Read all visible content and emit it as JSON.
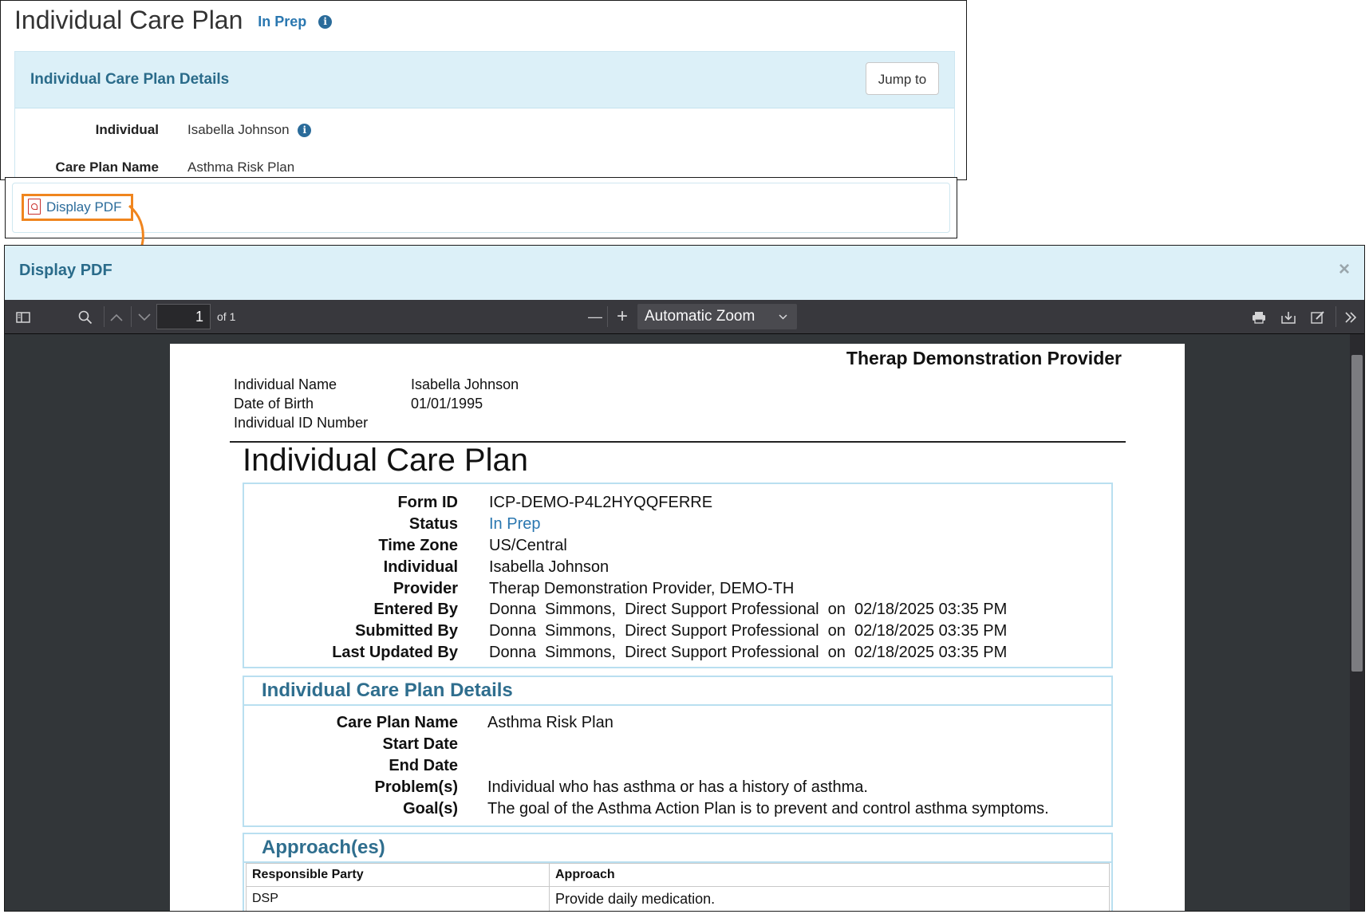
{
  "icp_page": {
    "title": "Individual Care Plan",
    "status": "In Prep",
    "details_title": "Individual Care Plan Details",
    "jump_to_label": "Jump to",
    "fields": [
      {
        "label": "Individual",
        "value": "Isabella Johnson"
      },
      {
        "label": "Care Plan Name",
        "value": "Asthma Risk Plan"
      }
    ]
  },
  "display_pdf_link": "Display PDF",
  "modal": {
    "title": "Display PDF",
    "close": "×"
  },
  "viewer_toolbar": {
    "page_number": "1",
    "page_count": "of 1",
    "zoom": "Automatic Zoom",
    "zoom_out": "—",
    "zoom_in": "+",
    "icons": [
      "sidebar-toggle-icon",
      "search-icon",
      "previous-page-icon",
      "next-page-icon",
      "print-icon",
      "download-icon",
      "edit-icon",
      "tools-icon"
    ]
  },
  "pdf": {
    "provider_heading": "Therap Demonstration Provider",
    "header_info": [
      {
        "label": "Individual Name",
        "value": "Isabella Johnson"
      },
      {
        "label": "Date of Birth",
        "value": "01/01/1995"
      },
      {
        "label": "Individual ID Number",
        "value": ""
      }
    ],
    "doc_title": "Individual Care Plan",
    "form_info": [
      {
        "label": "Form ID",
        "value": "ICP-DEMO-P4L2HYQQFERRE"
      },
      {
        "label": "Status",
        "value": "In Prep"
      },
      {
        "label": "Time Zone",
        "value": "US/Central"
      },
      {
        "label": "Individual",
        "value": "Isabella Johnson"
      },
      {
        "label": "Provider",
        "value": "Therap Demonstration Provider, DEMO-TH"
      },
      {
        "label": "Entered By",
        "value": "Donna  Simmons,  Direct Support Professional  on  02/18/2025 03:35 PM"
      },
      {
        "label": "Submitted By",
        "value": "Donna  Simmons,  Direct Support Professional  on  02/18/2025 03:35 PM"
      },
      {
        "label": "Last Updated By",
        "value": "Donna  Simmons,  Direct Support Professional  on  02/18/2025 03:35 PM"
      }
    ],
    "details_section": {
      "title": "Individual Care Plan Details",
      "fields": [
        {
          "label": "Care Plan Name",
          "value": "Asthma Risk Plan"
        },
        {
          "label": "Start Date",
          "value": ""
        },
        {
          "label": "End Date",
          "value": ""
        },
        {
          "label": "Problem(s)",
          "value": "Individual who has asthma or has a history of asthma."
        },
        {
          "label": "Goal(s)",
          "value": "The goal of the Asthma Action Plan is to prevent and control asthma symptoms."
        }
      ]
    },
    "approaches_section": {
      "title": "Approach(es)",
      "columns": [
        "Responsible Party",
        "Approach"
      ],
      "rows": [
        [
          "DSP",
          "Provide daily medication."
        ]
      ]
    }
  },
  "colors": {
    "accent_blue": "#2a77b0",
    "header_bg": "#dcf0f8",
    "highlight_orange": "#f0851e",
    "pdf_icon_red": "#c9302c",
    "viewer_bg": "#323639",
    "toolbar_bg": "#38383d"
  }
}
